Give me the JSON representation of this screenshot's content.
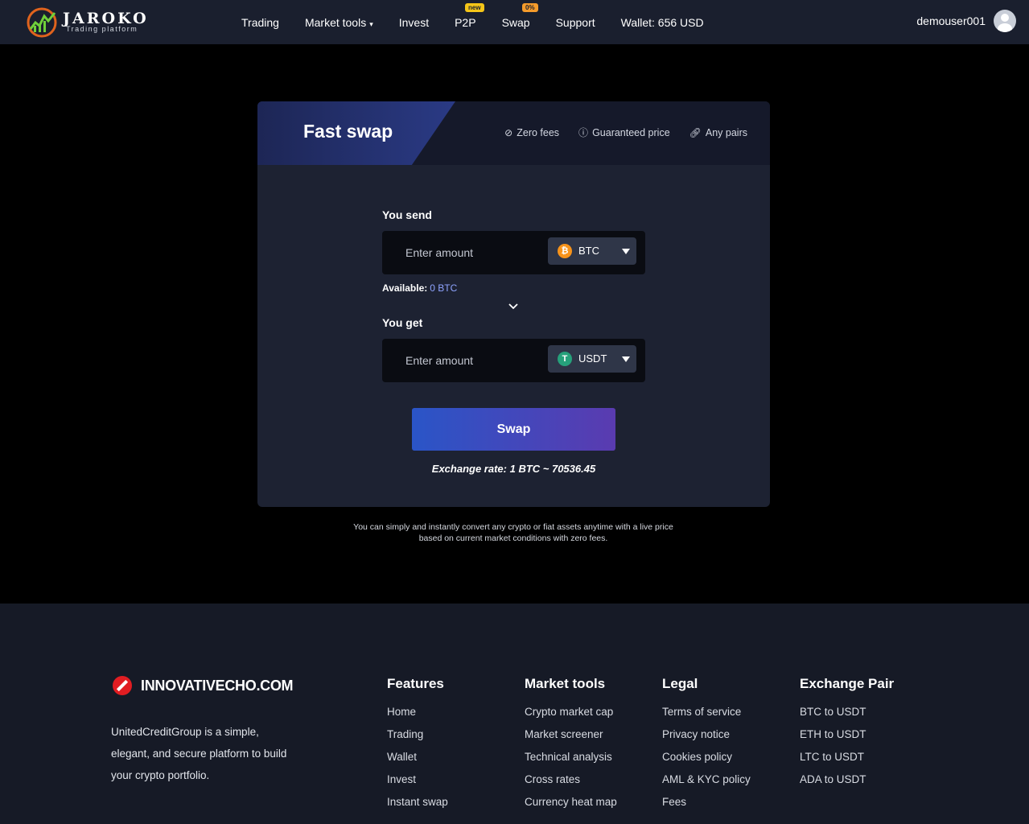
{
  "header": {
    "logo_title": "JAROKO",
    "logo_subtitle": "Trading platform",
    "nav": [
      {
        "label": "Trading"
      },
      {
        "label": "Market tools",
        "caret": "▾"
      },
      {
        "label": "Invest"
      },
      {
        "label": "P2P",
        "badge": "new",
        "badge_color": "#f5c518"
      },
      {
        "label": "Swap",
        "badge": "0%",
        "badge_color": "#f59b2b"
      },
      {
        "label": "Support"
      },
      {
        "label": "Wallet: 656 USD"
      }
    ],
    "username": "demouser001"
  },
  "swap_card": {
    "title": "Fast swap",
    "features": [
      {
        "icon": "zero-fees-icon",
        "label": "Zero fees"
      },
      {
        "icon": "guaranteed-price-icon",
        "label": "Guaranteed price"
      },
      {
        "icon": "link-icon",
        "label": "Any pairs"
      }
    ],
    "send_label": "You send",
    "send_placeholder": "Enter amount",
    "send_currency": "BTC",
    "send_coin_glyph": "₿",
    "send_coin_color": "#f7931a",
    "available_label": "Available:",
    "available_value": "0 BTC",
    "get_label": "You get",
    "get_placeholder": "Enter amount",
    "get_currency": "USDT",
    "get_coin_glyph": "T",
    "get_coin_color": "#26a17b",
    "swap_button": "Swap",
    "exchange_rate": "Exchange rate: 1 BTC ~ 70536.45"
  },
  "note_line1": "You can simply and instantly convert any crypto or fiat assets anytime with a live price",
  "note_line2": "based on current market conditions with zero fees.",
  "footer": {
    "brand": "INNOVATIVECHO.COM",
    "about": "UnitedCreditGroup is a simple, elegant, and secure platform to build your crypto portfolio.",
    "columns": [
      {
        "title": "Features",
        "links": [
          "Home",
          "Trading",
          "Wallet",
          "Invest",
          "Instant swap"
        ]
      },
      {
        "title": "Market tools",
        "links": [
          "Crypto market cap",
          "Market screener",
          "Technical analysis",
          "Cross rates",
          "Currency heat map"
        ]
      },
      {
        "title": "Legal",
        "links": [
          "Terms of service",
          "Privacy notice",
          "Cookies policy",
          "AML & KYC policy",
          "Fees"
        ]
      },
      {
        "title": "Exchange Pair",
        "links": [
          "BTC to USDT",
          "ETH to USDT",
          "LTC to USDT",
          "ADA to USDT"
        ]
      }
    ]
  },
  "colors": {
    "accent": "#2a55c7",
    "accent2": "#5a3bb0",
    "header_bg": "#1a1f2e",
    "card_bg": "#1d2232"
  }
}
